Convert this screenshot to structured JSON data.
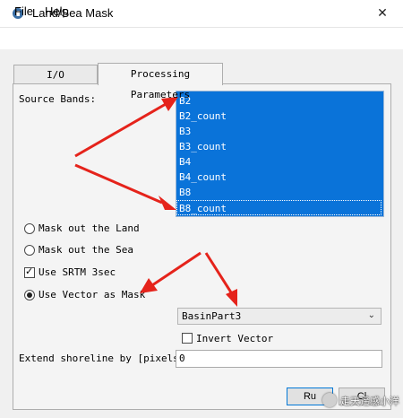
{
  "window": {
    "title": "Land/Sea Mask",
    "close_symbol": "✕"
  },
  "menu": [
    "File",
    "Help"
  ],
  "tabs": [
    {
      "label": "I/O Parameters",
      "active": false
    },
    {
      "label": "Processing Parameters",
      "active": true
    }
  ],
  "source_bands": {
    "label": "Source Bands:",
    "items": [
      "B2",
      "B2_count",
      "B3",
      "B3_count",
      "B4",
      "B4_count",
      "B8",
      "B8_count"
    ],
    "all_selected": true,
    "selection_color": "#0a73d9"
  },
  "options": {
    "mask_land": {
      "label": "Mask out the Land",
      "selected": false
    },
    "mask_sea": {
      "label": "Mask out the Sea",
      "selected": false
    },
    "use_srtm": {
      "label": "Use SRTM 3sec",
      "checked": true,
      "mark": "✓"
    },
    "use_vector": {
      "label": "Use Vector as Mask",
      "selected": true
    }
  },
  "vector_select": {
    "value": "BasinPart3"
  },
  "invert_vector": {
    "label": "Invert Vector",
    "checked": false
  },
  "extend_shoreline": {
    "label": "Extend shoreline by [pixels]:",
    "value": "0"
  },
  "buttons": {
    "run": "Ru",
    "close": "Cl"
  },
  "watermark": {
    "text": "走天遥感小洋"
  },
  "annotation_color": "#e5231b"
}
